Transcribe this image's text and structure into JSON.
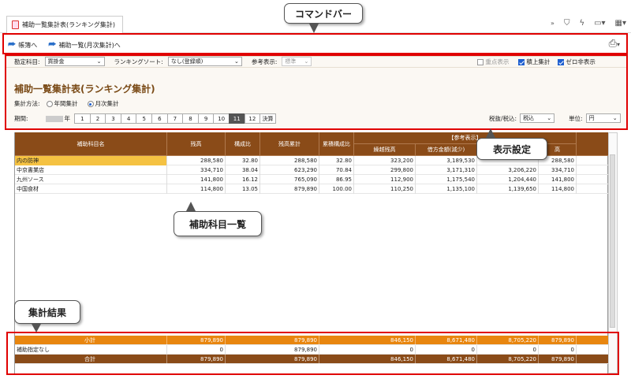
{
  "tab": {
    "title": "補助一覧集計表(ランキング集計)"
  },
  "toolbar": {
    "icons": [
      "double-chevron-icon",
      "bookmark-icon",
      "lightning-icon",
      "window-icon",
      "calendar-icon"
    ]
  },
  "commands": {
    "back_label": "帳簿へ",
    "monthly_label": "補助一覧(月次集計)へ"
  },
  "filters": {
    "account_label": "勘定科目:",
    "account_value": "買掛金",
    "sort_label": "ランキングソート:",
    "sort_value": "なし(登録順)",
    "ref_label": "参考表示:",
    "ref_value": "標準",
    "important_label": "重点表示",
    "cumulative_label": "積上集計",
    "zero_hide_label": "ゼロ非表示"
  },
  "report": {
    "title": "補助一覧集計表(ランキング集計)",
    "method_label": "集計方法:",
    "annual_label": "年間集計",
    "monthly_label": "月次集計",
    "period_label": "期間:",
    "year_suffix": "年",
    "months": [
      "1",
      "2",
      "3",
      "4",
      "5",
      "6",
      "7",
      "8",
      "9",
      "10",
      "11",
      "12",
      "決算"
    ],
    "active_month": "11",
    "tax_label": "税抜/税込:",
    "tax_value": "税込",
    "unit_label": "単位:",
    "unit_value": "円"
  },
  "table": {
    "headers": {
      "name": "補助科目名",
      "balance": "残高",
      "ratio": "構成比",
      "cumulative": "残高累計",
      "cum_ratio": "累積構成比",
      "ref_group": "【参考表示】",
      "carry": "繰越残高",
      "credit": "借方金額(減少)",
      "extra1": "",
      "extra2": "高"
    },
    "rows": [
      {
        "name": "内の防神",
        "balance": "288,580",
        "ratio": "32.80",
        "cumulative": "288,580",
        "cum_ratio": "32.80",
        "carry": "323,200",
        "credit": "3,189,530",
        "c3": "",
        "c4": "288,580"
      },
      {
        "name": "中京書業店",
        "balance": "334,710",
        "ratio": "38.04",
        "cumulative": "623,290",
        "cum_ratio": "70.84",
        "carry": "299,800",
        "credit": "3,171,310",
        "c3": "3,206,220",
        "c4": "334,710"
      },
      {
        "name": "九州ソース",
        "balance": "141,800",
        "ratio": "16.12",
        "cumulative": "765,090",
        "cum_ratio": "86.95",
        "carry": "112,900",
        "credit": "1,175,540",
        "c3": "1,204,440",
        "c4": "141,800"
      },
      {
        "name": "中国食材",
        "balance": "114,800",
        "ratio": "13.05",
        "cumulative": "879,890",
        "cum_ratio": "100.00",
        "carry": "110,250",
        "credit": "1,135,100",
        "c3": "1,139,650",
        "c4": "114,800"
      }
    ],
    "subtotal": {
      "label": "小計",
      "balance": "879,890",
      "cumulative": "879,890",
      "carry": "846,150",
      "credit": "8,671,480",
      "c3": "8,705,220",
      "c4": "879,890"
    },
    "unassigned": {
      "label": "補助指定なし",
      "balance": "0",
      "cumulative": "879,890",
      "carry": "0",
      "credit": "0",
      "c3": "0",
      "c4": "0"
    },
    "total": {
      "label": "合計",
      "balance": "879,890",
      "cumulative": "879,890",
      "carry": "846,150",
      "credit": "8,671,480",
      "c3": "8,705,220",
      "c4": "879,890"
    }
  },
  "callouts": {
    "command_bar": "コマンドバー",
    "display_settings": "表示設定",
    "sub_accounts": "補助科目一覧",
    "results": "集計結果"
  },
  "colors": {
    "header": "#8a4b18",
    "subtotal": "#e8860f",
    "highlight": "#f5c242",
    "annotation": "#e00000"
  }
}
